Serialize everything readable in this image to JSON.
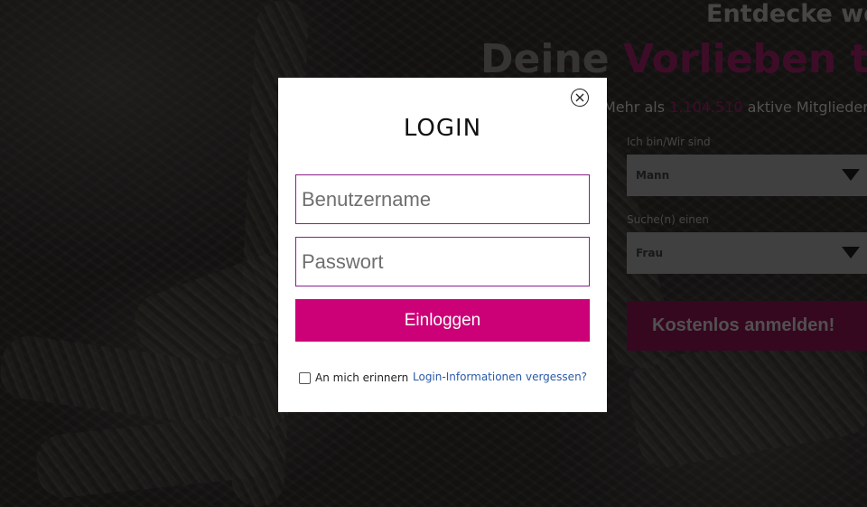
{
  "hero": {
    "top_line": "Entdecke wer",
    "title_part1": "Deine",
    "title_part2": "Vorlieben teilt",
    "subtitle_prefix": "Mehr als",
    "member_count": "1.104.510",
    "subtitle_suffix": "aktive Mitglieder"
  },
  "registration": {
    "iam_label": "Ich bin/Wir sind",
    "iam_value": "Mann",
    "seeking_label": "Suche(n) einen",
    "seeking_value": "Frau",
    "register_button": "Kostenlos anmelden!"
  },
  "login_modal": {
    "title": "LOGIN",
    "username_placeholder": "Benutzername",
    "password_placeholder": "Passwort",
    "login_button": "Einloggen",
    "remember_label": "An mich erinnern",
    "forgot_link": "Login-Informationen vergessen?",
    "close_icon": "close-icon"
  },
  "colors": {
    "accent": "#cc0077",
    "input_border": "#8a1f8a",
    "link": "#2a5aa8"
  }
}
